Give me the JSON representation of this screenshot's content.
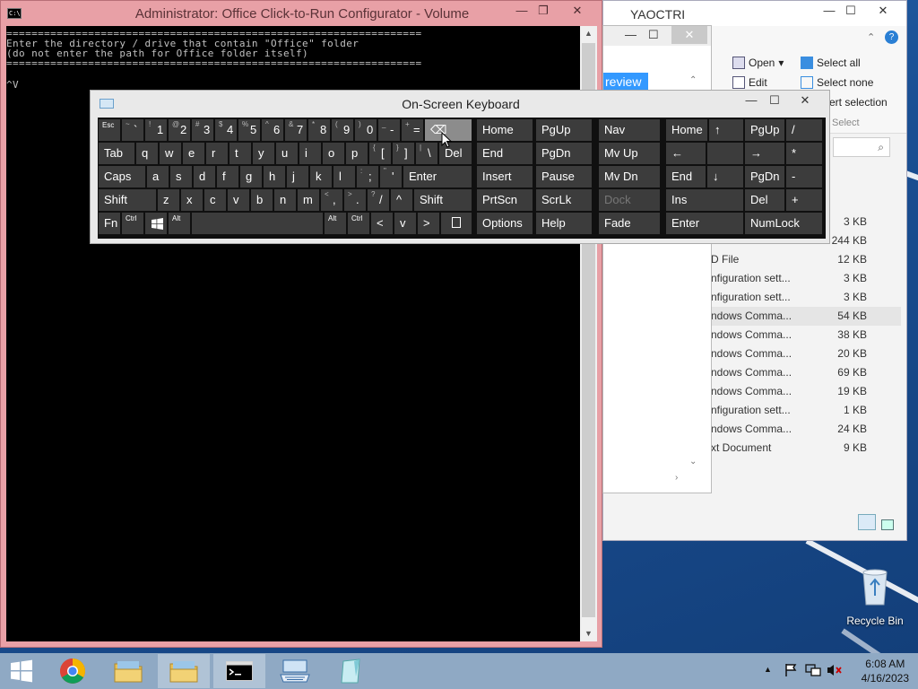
{
  "console": {
    "title": "Administrator:  Office Click-to-Run Configurator - Volume",
    "icon_text": "C:\\",
    "lines": [
      "==================================================================",
      "Enter the directory / drive that contain \"Office\" folder",
      "(do not enter the path for Office folder itself)",
      "==================================================================",
      "",
      "^V"
    ]
  },
  "explorer": {
    "title": "YAOCTRI",
    "selected_text": "review",
    "ribbon": {
      "open": "Open",
      "edit": "Edit",
      "select_all": "Select all",
      "select_none": "Select none",
      "invert_selection": "ert selection",
      "select_group": "Select"
    },
    "files": [
      {
        "name": "",
        "size": "3 KB"
      },
      {
        "name": "",
        "size": "244 KB"
      },
      {
        "name": "D File",
        "size": "12 KB"
      },
      {
        "name": "nfiguration sett...",
        "size": "3 KB"
      },
      {
        "name": "nfiguration sett...",
        "size": "3 KB"
      },
      {
        "name": "ndows Comma...",
        "size": "54 KB"
      },
      {
        "name": "ndows Comma...",
        "size": "38 KB"
      },
      {
        "name": "ndows Comma...",
        "size": "20 KB"
      },
      {
        "name": "ndows Comma...",
        "size": "69 KB"
      },
      {
        "name": "ndows Comma...",
        "size": "19 KB"
      },
      {
        "name": "nfiguration sett...",
        "size": "1 KB"
      },
      {
        "name": "ndows Comma...",
        "size": "24 KB"
      },
      {
        "name": "xt Document",
        "size": "9 KB"
      }
    ]
  },
  "osk": {
    "title": "On-Screen Keyboard",
    "keys": {
      "esc": "Esc",
      "tilde_sup": "~",
      "tilde": "`",
      "n1s": "!",
      "n1": "1",
      "n2s": "@",
      "n2": "2",
      "n3s": "#",
      "n3": "3",
      "n4s": "$",
      "n4": "4",
      "n5s": "%",
      "n5": "5",
      "n6s": "^",
      "n6": "6",
      "n7s": "&",
      "n7": "7",
      "n8s": "*",
      "n8": "8",
      "n9s": "(",
      "n9": "9",
      "n0s": ")",
      "n0": "0",
      "minus_s": "_",
      "minus": "-",
      "eq_s": "+",
      "eq": "=",
      "backspace": "⌫",
      "tab": "Tab",
      "q": "q",
      "w": "w",
      "e": "e",
      "r": "r",
      "t": "t",
      "y": "y",
      "u": "u",
      "i": "i",
      "o": "o",
      "p": "p",
      "lbr_s": "{",
      "lbr": "[",
      "rbr_s": "}",
      "rbr": "]",
      "bsl_s": "|",
      "bsl": "\\",
      "del": "Del",
      "caps": "Caps",
      "a": "a",
      "s": "s",
      "d": "d",
      "f": "f",
      "g": "g",
      "h": "h",
      "j": "j",
      "k": "k",
      "l": "l",
      "semi_s": ":",
      "semi": ";",
      "quote_s": "\"",
      "quote": "'",
      "enter": "Enter",
      "shift": "Shift",
      "z": "z",
      "x": "x",
      "c": "c",
      "v": "v",
      "b": "b",
      "n": "n",
      "m": "m",
      "comma_s": "<",
      "comma": ",",
      "period_s": ">",
      "period": ".",
      "slash_s": "?",
      "slash": "/",
      "up": "^",
      "rshift": "Shift",
      "fn": "Fn",
      "ctrl": "Ctrl",
      "alt": "Alt",
      "ralt": "Alt",
      "rctrl": "Ctrl",
      "left": "<",
      "down": "v",
      "right": ">",
      "home": "Home",
      "pgup": "PgUp",
      "nav": "Nav",
      "end": "End",
      "pgdn": "PgDn",
      "mvup": "Mv Up",
      "insert": "Insert",
      "pause": "Pause",
      "mvdn": "Mv Dn",
      "prtscn": "PrtScn",
      "scrlk": "ScrLk",
      "dock": "Dock",
      "options": "Options",
      "help": "Help",
      "fade": "Fade",
      "np_home": "Home",
      "np_up": "↑",
      "np_pgup": "PgUp",
      "np_div": "/",
      "np_left": "←",
      "np_right": "→",
      "np_mul": "*",
      "np_end": "End",
      "np_down": "↓",
      "np_pgdn": "PgDn",
      "np_sub": "-",
      "np_ins": "Ins",
      "np_del": "Del",
      "np_add": "+",
      "np_enter": "Enter",
      "np_numlock": "NumLock"
    }
  },
  "desktop": {
    "recycle_bin": "Recycle Bin"
  },
  "taskbar": {
    "time": "6:08 AM",
    "date": "4/16/2023"
  }
}
